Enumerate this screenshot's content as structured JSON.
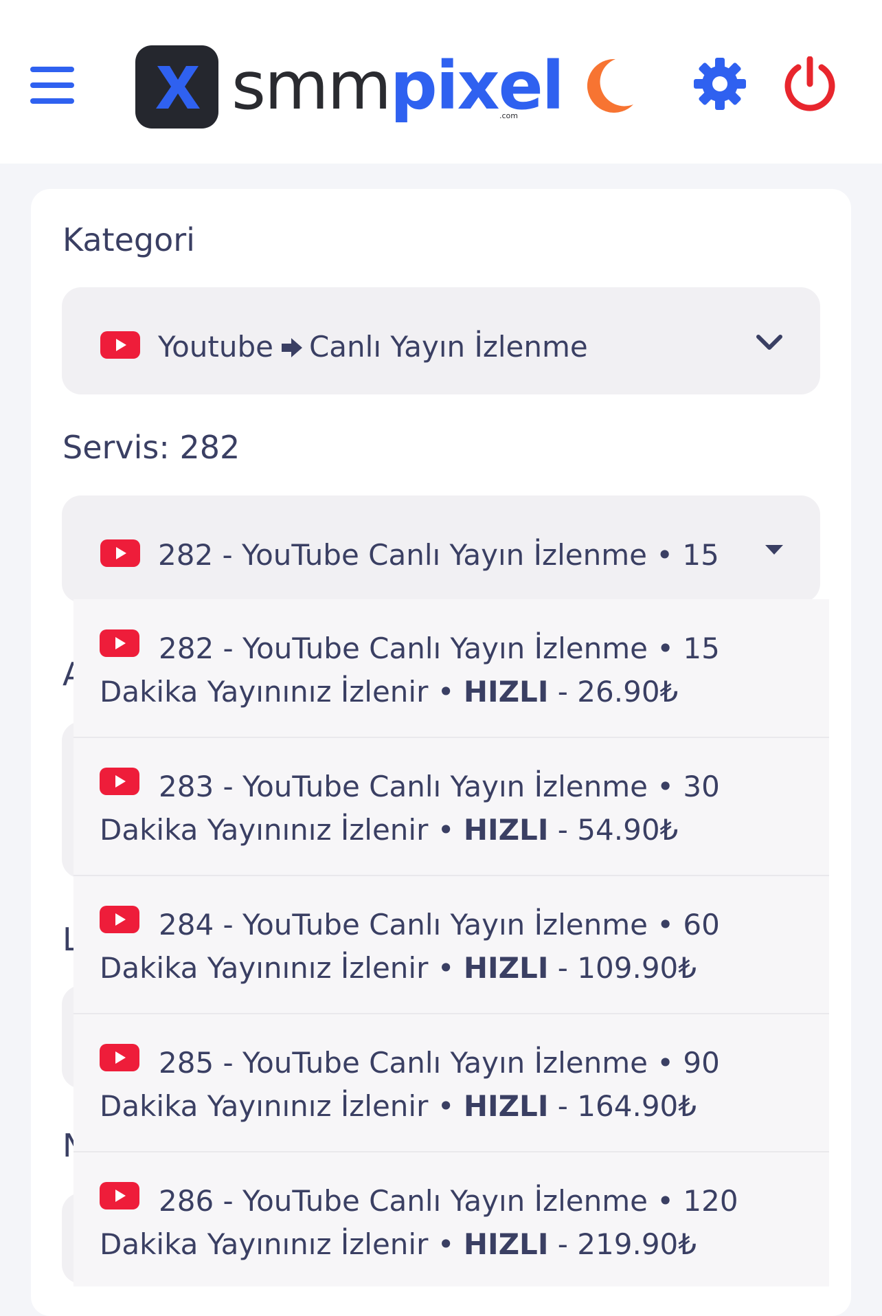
{
  "header": {
    "logo_prefix": "smm",
    "logo_brand": "pixel",
    "logo_suffix": ".com",
    "logo_mark_letter": "X",
    "icons": [
      "hamburger-menu-icon",
      "moon-icon",
      "gear-icon",
      "power-icon"
    ]
  },
  "colors": {
    "accent_blue": "#2f61f0",
    "moon_orange": "#f77432",
    "power_red": "#e8262d",
    "youtube_red": "#ee1d3a",
    "text": "#3a3f63"
  },
  "category": {
    "label": "Kategori",
    "platform": "Youtube",
    "subcategory": "Canlı Yayın İzlenme"
  },
  "service": {
    "label": "Servis: 282",
    "selected": "282 - YouTube Canlı Yayın İzlenme • 15"
  },
  "dropdown": {
    "items": [
      {
        "line1": "282 - YouTube Canlı Yayın İzlenme • 15",
        "line2_a": "Dakika Yayınınız İzlenir • ",
        "speed": "HIZLI",
        "price": " - 26.90₺"
      },
      {
        "line1": "283 - YouTube Canlı Yayın İzlenme • 30",
        "line2_a": "Dakika Yayınınız İzlenir • ",
        "speed": "HIZLI",
        "price": " - 54.90₺"
      },
      {
        "line1": "284 - YouTube Canlı Yayın İzlenme • 60",
        "line2_a": "Dakika Yayınınız İzlenir • ",
        "speed": "HIZLI",
        "price": " - 109.90₺"
      },
      {
        "line1": "285 - YouTube Canlı Yayın İzlenme • 90",
        "line2_a": "Dakika Yayınınız İzlenir • ",
        "speed": "HIZLI",
        "price": " - 164.90₺"
      },
      {
        "line1": "286 - YouTube Canlı Yayın İzlenme • 120",
        "line2_a": "Dakika Yayınınız İzlenir • ",
        "speed": "HIZLI",
        "price": " - 219.90₺"
      }
    ]
  },
  "covered": {
    "label_a": "A",
    "label_l": "L",
    "label_m": "N"
  }
}
